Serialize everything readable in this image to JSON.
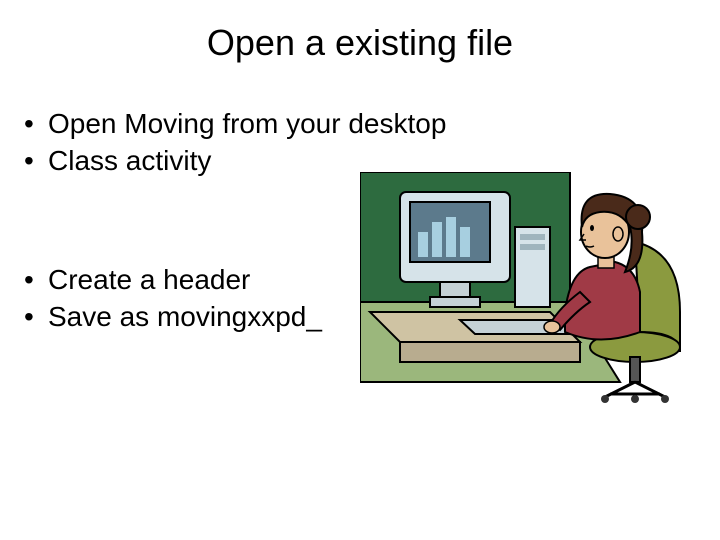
{
  "title": "Open a existing file",
  "bullets_top": [
    "Open Moving from your desktop",
    "Class activity"
  ],
  "bullets_bottom": [
    "Create a header",
    "Save as movingxxpd_"
  ],
  "clipart": {
    "name": "person-at-computer-clipart",
    "colors": {
      "wall": "#2d6b3f",
      "floor": "#9bb77c",
      "monitor_body": "#d6e3e9",
      "monitor_screen": "#5c7a8c",
      "bars": "#a7cfe0",
      "keyboard": "#c5d1d6",
      "desk": "#cfc3a3",
      "chair": "#8b9a3f",
      "hair": "#4a2a1a",
      "skin": "#e9c29a",
      "shirt": "#a03a46",
      "outline": "#000000"
    }
  }
}
